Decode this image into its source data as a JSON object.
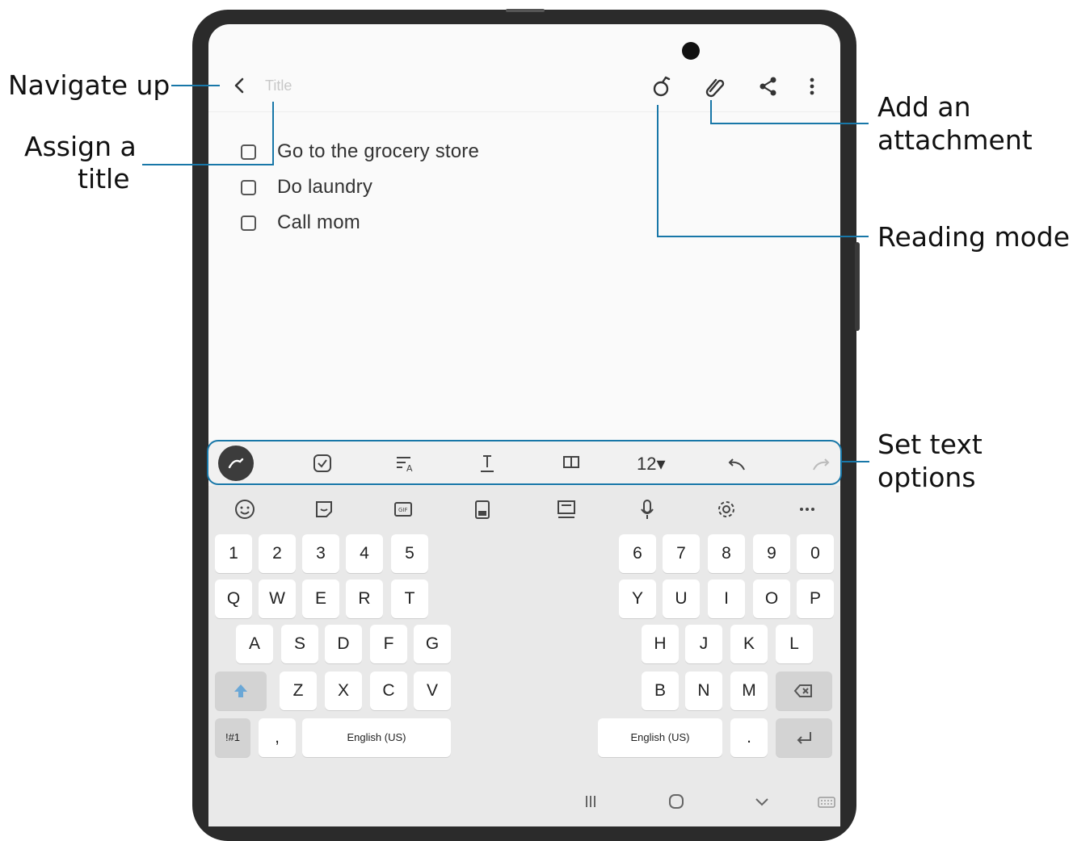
{
  "callouts": {
    "navigate_up": "Navigate up",
    "assign_title_1": "Assign a",
    "assign_title_2": "title",
    "add_attachment_1": "Add an",
    "add_attachment_2": "attachment",
    "reading_mode": "Reading mode",
    "text_options_1": "Set text",
    "text_options_2": "options"
  },
  "appbar": {
    "title_placeholder": "Title",
    "icons": [
      "back-icon",
      "reading-mode-icon",
      "paperclip-icon",
      "share-icon",
      "more-vertical-icon"
    ]
  },
  "checklist": [
    {
      "text": "Go to the grocery store",
      "checked": false
    },
    {
      "text": "Do laundry",
      "checked": false
    },
    {
      "text": "Call mom",
      "checked": false
    }
  ],
  "text_toolbar": {
    "font_size": "12▾",
    "icons": [
      "pen-icon",
      "checkbox-icon",
      "text-style-icon",
      "text-format-icon",
      "paragraph-icon",
      "undo-icon",
      "redo-icon"
    ]
  },
  "keyboard": {
    "toolbar_icons": [
      "emoji-icon",
      "sticker-icon",
      "gif-icon",
      "clipboard-icon",
      "split-keyboard-icon",
      "mic-icon",
      "settings-icon",
      "more-horizontal-icon"
    ],
    "left": {
      "numbers": [
        "1",
        "2",
        "3",
        "4",
        "5"
      ],
      "row1": [
        "Q",
        "W",
        "E",
        "R",
        "T"
      ],
      "row2": [
        "A",
        "S",
        "D",
        "F",
        "G"
      ],
      "row3": [
        "Z",
        "X",
        "C",
        "V"
      ],
      "symbols_key": "!#1",
      "comma_key": ",",
      "space_label": "English (US)"
    },
    "right": {
      "numbers": [
        "6",
        "7",
        "8",
        "9",
        "0"
      ],
      "row1": [
        "Y",
        "U",
        "I",
        "O",
        "P"
      ],
      "row2": [
        "H",
        "J",
        "K",
        "L"
      ],
      "row3": [
        "B",
        "N",
        "M"
      ],
      "space_label": "English (US)",
      "period_key": "."
    }
  },
  "navbar": {
    "icons": [
      "recents-icon",
      "home-icon",
      "hide-keyboard-icon",
      "keyboard-icon"
    ]
  },
  "colors": {
    "callout_line": "#1877a8",
    "device_frame": "#2b2b2b"
  }
}
